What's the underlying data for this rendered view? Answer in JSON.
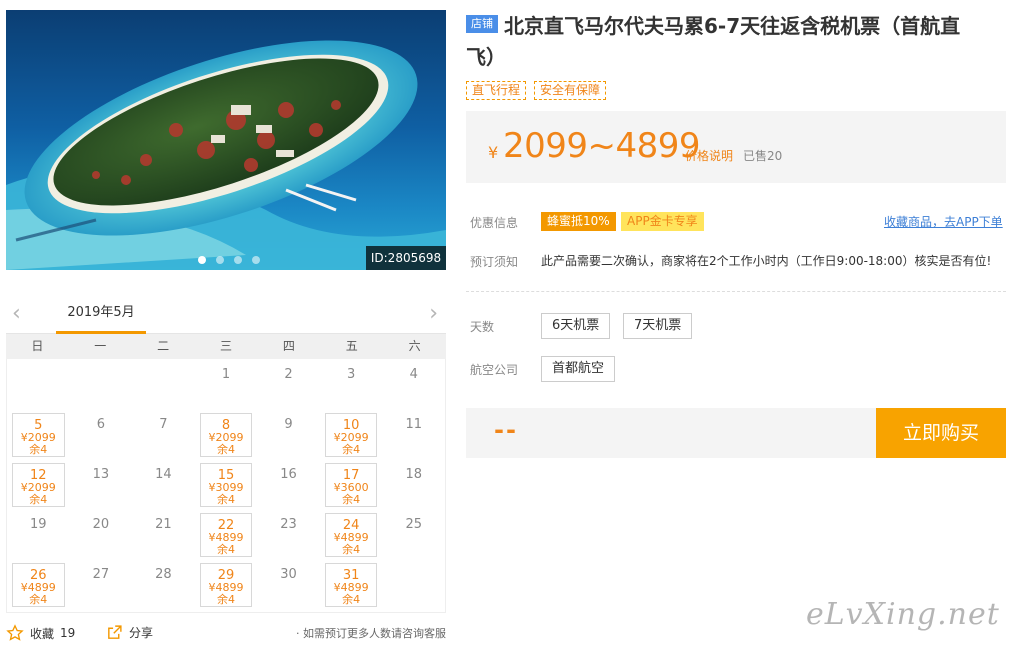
{
  "photo": {
    "id_label": "ID:2805698",
    "dots": 4,
    "active_dot": 0
  },
  "calendar": {
    "month_label": "2019年5月",
    "weekdays": [
      "日",
      "一",
      "二",
      "三",
      "四",
      "五",
      "六"
    ],
    "leading_blanks": 3,
    "days": [
      {
        "day": "1"
      },
      {
        "day": "2"
      },
      {
        "day": "3"
      },
      {
        "day": "4"
      },
      {
        "day": "5",
        "price": "¥2099",
        "stock": "余4"
      },
      {
        "day": "6"
      },
      {
        "day": "7"
      },
      {
        "day": "8",
        "price": "¥2099",
        "stock": "余4"
      },
      {
        "day": "9"
      },
      {
        "day": "10",
        "price": "¥2099",
        "stock": "余4"
      },
      {
        "day": "11"
      },
      {
        "day": "12",
        "price": "¥2099",
        "stock": "余4"
      },
      {
        "day": "13"
      },
      {
        "day": "14"
      },
      {
        "day": "15",
        "price": "¥3099",
        "stock": "余4"
      },
      {
        "day": "16"
      },
      {
        "day": "17",
        "price": "¥3600",
        "stock": "余4"
      },
      {
        "day": "18"
      },
      {
        "day": "19"
      },
      {
        "day": "20"
      },
      {
        "day": "21"
      },
      {
        "day": "22",
        "price": "¥4899",
        "stock": "余4"
      },
      {
        "day": "23"
      },
      {
        "day": "24",
        "price": "¥4899",
        "stock": "余4"
      },
      {
        "day": "25"
      },
      {
        "day": "26",
        "price": "¥4899",
        "stock": "余4"
      },
      {
        "day": "27"
      },
      {
        "day": "28"
      },
      {
        "day": "29",
        "price": "¥4899",
        "stock": "余4"
      },
      {
        "day": "30"
      },
      {
        "day": "31",
        "price": "¥4899",
        "stock": "余4"
      }
    ]
  },
  "bottom": {
    "fav_label": "收藏",
    "fav_count": "19",
    "share_label": "分享",
    "note": "· 如需预订更多人数请咨询客服"
  },
  "product": {
    "shop_tag": "店铺",
    "title": "北京直飞马尔代夫马累6-7天往返含税机票（首航直飞）",
    "tags": [
      "直飞行程",
      "安全有保障"
    ],
    "yen": "¥",
    "price_range": "2099~4899",
    "price_note": "价格说明",
    "sold": "已售20"
  },
  "offers": {
    "label": "优惠信息",
    "badge1": "蜂蜜抵10%",
    "badge2": "APP金卡专享",
    "fav_link": "收藏商品，去APP下单"
  },
  "booking": {
    "label": "预订须知",
    "text": "此产品需要二次确认，商家将在2个工作小时内（工作日9:00-18:00）核实是否有位!"
  },
  "options": {
    "days_label": "天数",
    "days": [
      "6天机票",
      "7天机票"
    ],
    "airline_label": "航空公司",
    "airlines": [
      "首都航空"
    ]
  },
  "buy": {
    "price": "--",
    "button": "立即购买"
  },
  "watermark": "eLvXing.net"
}
